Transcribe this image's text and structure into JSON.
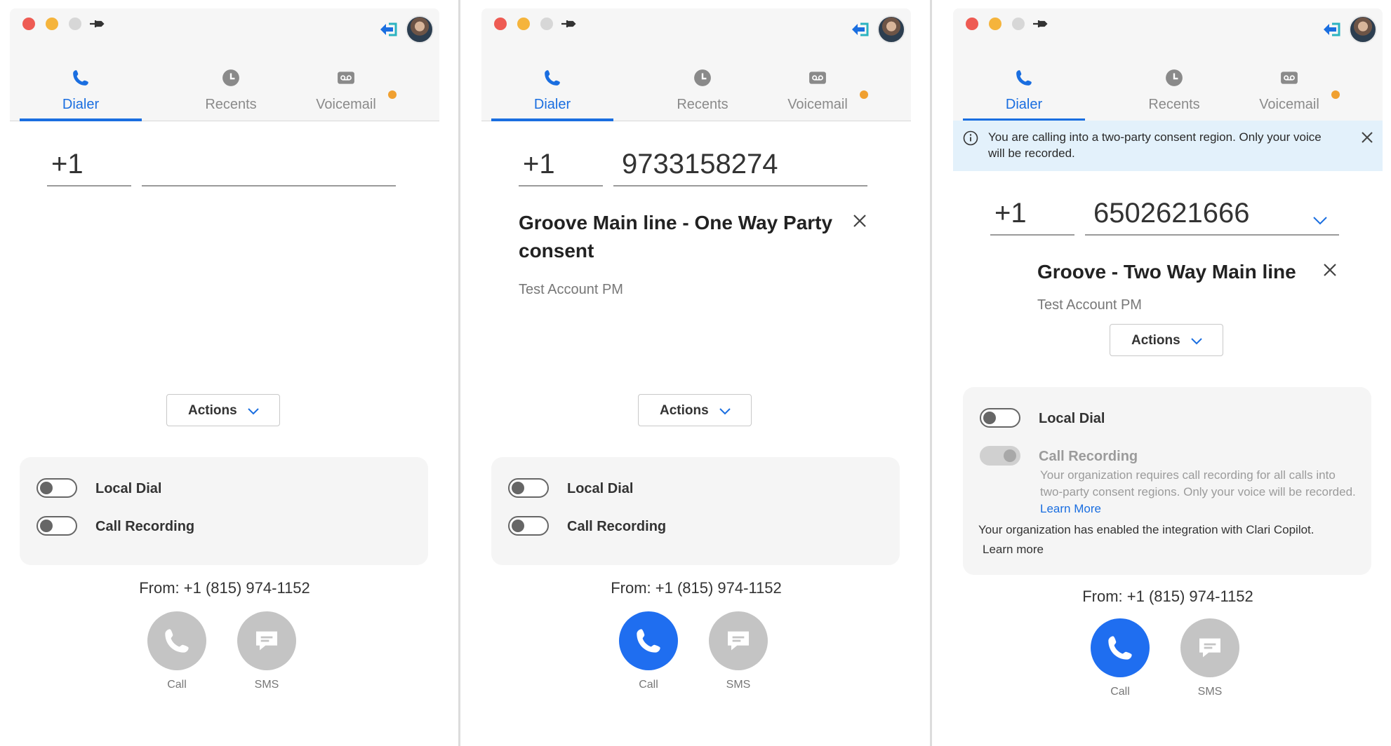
{
  "tabs": [
    {
      "label": "Dialer"
    },
    {
      "label": "Recents"
    },
    {
      "label": "Voicemail"
    }
  ],
  "colors": {
    "accent": "#1a6ee0",
    "call_active": "#1f6ef0",
    "badge": "#f0a030",
    "banner_bg": "#e3f1fb"
  },
  "panels": [
    {
      "country_code": "+1",
      "number": "",
      "actions_label": "Actions",
      "local_dial_label": "Local Dial",
      "call_recording_label": "Call Recording",
      "from_text": "From: +1 (815) 974-1152",
      "call_label": "Call",
      "sms_label": "SMS"
    },
    {
      "country_code": "+1",
      "number": "9733158274",
      "contact_name": "Groove Main line - One Way Party consent",
      "contact_account": "Test Account PM",
      "actions_label": "Actions",
      "local_dial_label": "Local Dial",
      "call_recording_label": "Call Recording",
      "from_text": "From: +1 (815) 974-1152",
      "call_label": "Call",
      "sms_label": "SMS"
    },
    {
      "consent_banner": "You are calling into a two-party consent region. Only your voice will be recorded.",
      "country_code": "+1",
      "number": "6502621666",
      "contact_name": "Groove - Two Way Main line",
      "contact_account": "Test Account PM",
      "actions_label": "Actions",
      "local_dial_label": "Local Dial",
      "call_recording_label": "Call Recording",
      "recording_note": "Your organization requires call recording for all calls into two-party consent regions. Only your voice will be recorded.",
      "learn_more_1": "Learn More",
      "copilot_note": "Your organization has enabled the integration with Clari Copilot.",
      "learn_more_2": "Learn more",
      "from_text": "From: +1 (815) 974-1152",
      "call_label": "Call",
      "sms_label": "SMS"
    }
  ]
}
